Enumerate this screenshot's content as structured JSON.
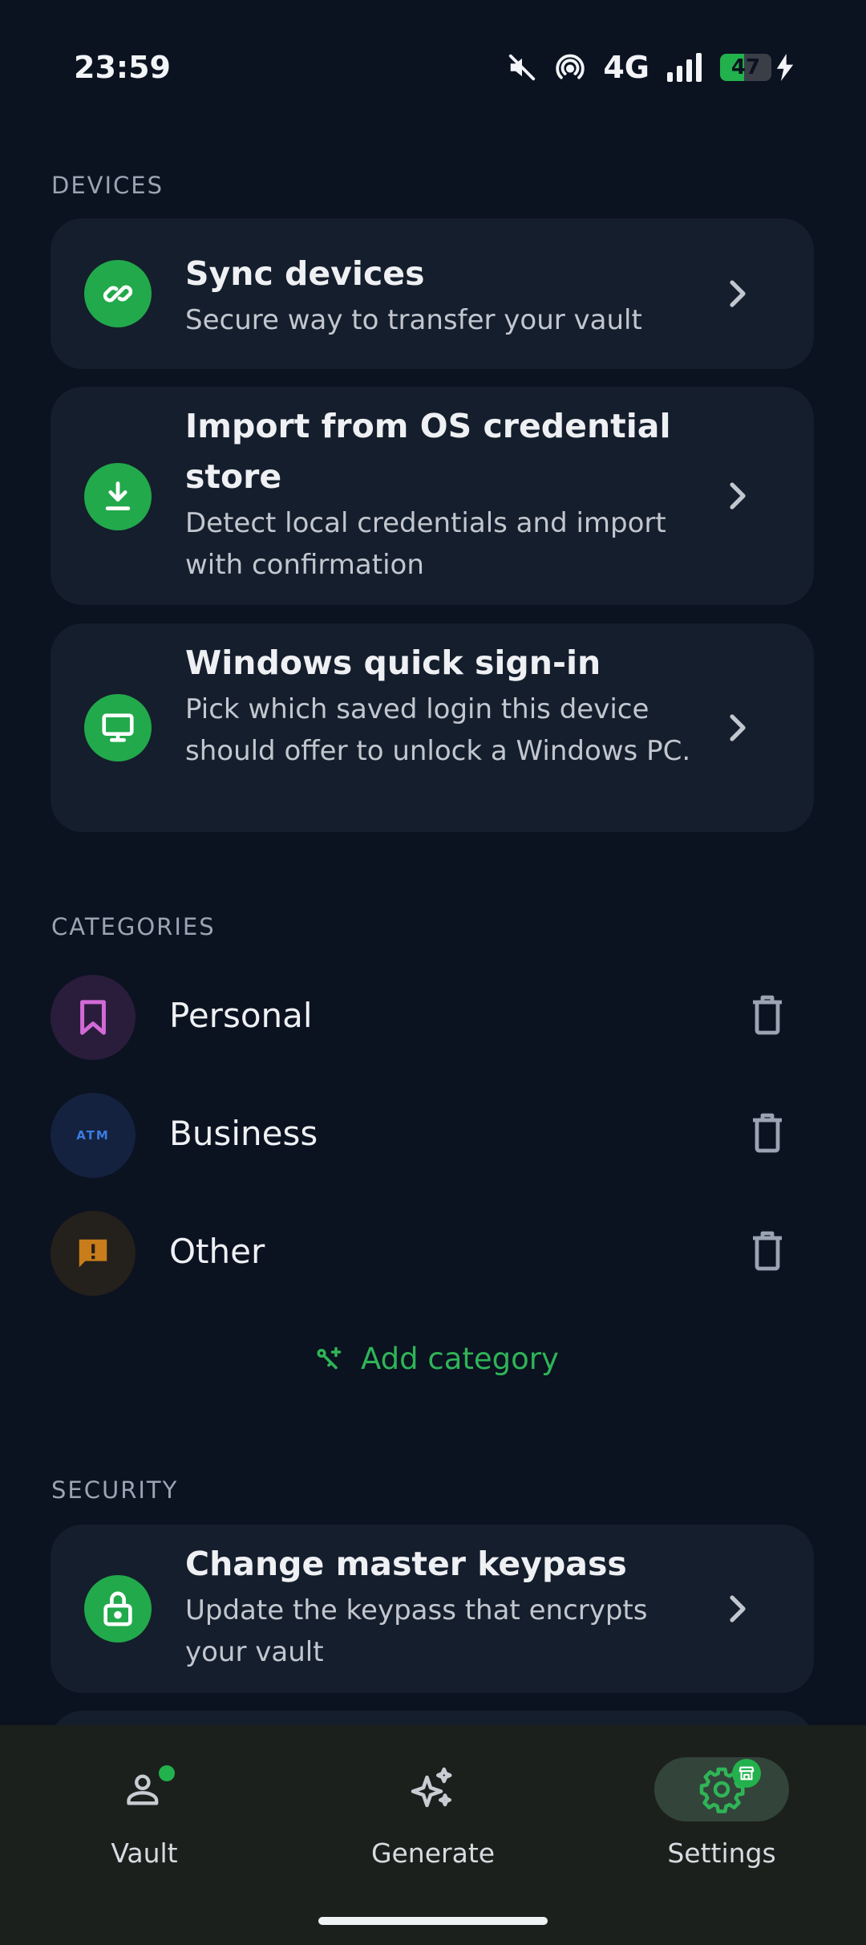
{
  "status": {
    "time": "23:59",
    "network": "4G",
    "battery": "47",
    "battery_fraction": 0.47
  },
  "devices": {
    "section_title": "DEVICES",
    "items": [
      {
        "title": "Sync devices",
        "subtitle": "Secure way to transfer your vault",
        "icon": "link-icon"
      },
      {
        "title": "Import from OS credential store",
        "subtitle": "Detect local credentials and import with confirmation",
        "icon": "download-icon"
      },
      {
        "title": "Windows quick sign-in",
        "subtitle": "Pick which saved login this device should offer to unlock a Windows PC.",
        "icon": "monitor-icon"
      }
    ]
  },
  "categories": {
    "section_title": "CATEGORIES",
    "items": [
      {
        "label": "Personal",
        "icon": "bookmark-icon",
        "color": "#d26ad6"
      },
      {
        "label": "Business",
        "icon": "atm-icon",
        "color": "#3c7be0"
      },
      {
        "label": "Other",
        "icon": "report-icon",
        "color": "#c87d1a"
      }
    ],
    "add_label": "Add category"
  },
  "security": {
    "section_title": "SECURITY",
    "items": [
      {
        "title": "Change master keypass",
        "subtitle": "Update the keypass that encrypts your vault",
        "icon": "lock-icon"
      }
    ]
  },
  "nav": {
    "items": [
      {
        "label": "Vault",
        "icon": "person-icon"
      },
      {
        "label": "Generate",
        "icon": "sparkle-icon"
      },
      {
        "label": "Settings",
        "icon": "gear-icon",
        "active": true
      }
    ]
  },
  "colors": {
    "accent": "#22a94b",
    "background": "#0b1220",
    "card": "#151e2c"
  }
}
